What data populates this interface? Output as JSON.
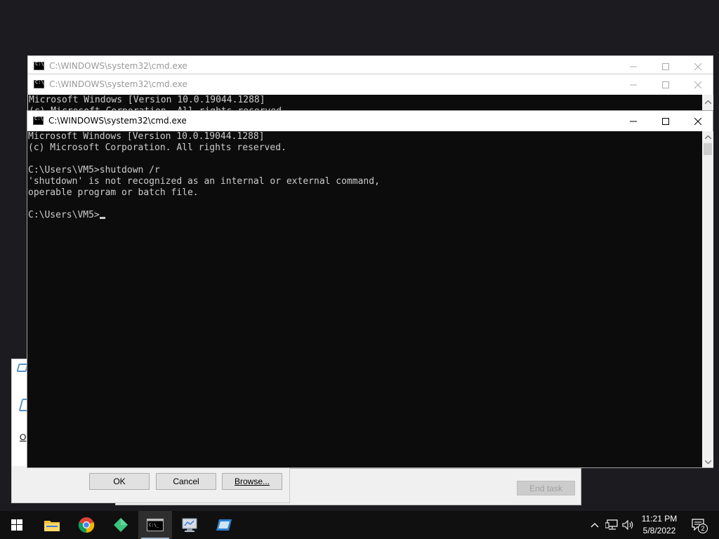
{
  "windows": {
    "back2": {
      "title": "C:\\WINDOWS\\system32\\cmd.exe"
    },
    "back1": {
      "title": "C:\\WINDOWS\\system32\\cmd.exe",
      "console_lines": [
        "Microsoft Windows [Version 10.0.19044.1288]",
        "(c) Microsoft Corporation. All rights reserved."
      ]
    },
    "front": {
      "title": "C:\\WINDOWS\\system32\\cmd.exe",
      "console_lines": [
        "Microsoft Windows [Version 10.0.19044.1288]",
        "(c) Microsoft Corporation. All rights reserved.",
        "",
        "C:\\Users\\VM5>shutdown /r",
        "'shutdown' is not recognized as an internal or external command,",
        "operable program or batch file.",
        ""
      ],
      "prompt": "C:\\Users\\VM5>"
    }
  },
  "run_dialog": {
    "partial_label": "O",
    "ok_label": "OK",
    "cancel_label": "Cancel",
    "browse_label": "Browse..."
  },
  "task_manager": {
    "end_task_label": "End task"
  },
  "taskbar": {
    "apps": [
      "start-icon",
      "file-explorer-icon",
      "chrome-icon",
      "green-diamond-app-icon",
      "command-prompt-icon",
      "remote-desktop-icon",
      "app-window-icon"
    ],
    "clock_time": "11:21 PM",
    "clock_date": "5/8/2022",
    "notification_count": "2"
  },
  "colors": {
    "console_bg": "#0c0c0c",
    "console_text": "#cccccc",
    "taskbar_bg": "#101010",
    "desktop_bg": "#1b1b20",
    "chrome_red": "#db4437",
    "diamond_green": "#3cc47c"
  }
}
